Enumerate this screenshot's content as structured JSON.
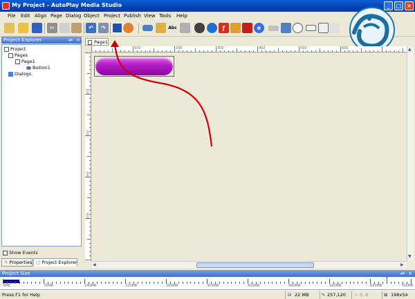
{
  "window": {
    "title": "My Project - AutoPlay Media Studio"
  },
  "menu": [
    "File",
    "Edit",
    "Align",
    "Page",
    "Dialog",
    "Object",
    "Project",
    "Publish",
    "View",
    "Tools",
    "Help"
  ],
  "toolbar": {
    "abc_label": "Abc"
  },
  "project_explorer": {
    "title": "Project Explorer",
    "tree": {
      "project": "Project",
      "pages": "Pages",
      "page1": "Page1",
      "button1": "Button1",
      "dialogs": "Dialogs"
    },
    "show_events_label": "Show Events",
    "tab_properties": "Properties",
    "tab_explorer": "Project Explorer"
  },
  "document": {
    "tab_label": "Page1",
    "ruler_labels": [
      "100",
      "200",
      "300",
      "400",
      "500",
      "600"
    ],
    "vruler_labels": [
      "100",
      "200",
      "300",
      "400"
    ]
  },
  "project_size": {
    "title": "Project Size",
    "fill_fraction": 0.04,
    "scale_labels": [
      "0MB",
      "70MB",
      "140MB",
      "210MB",
      "280MB",
      "350MB",
      "420MB",
      "490MB",
      "560MB",
      "630MB",
      "700MB"
    ]
  },
  "statusbar": {
    "help": "Press F1 for Help",
    "size": "22 MB",
    "coords": "257,120",
    "pos": "0, 0",
    "dims": "198x54"
  },
  "colors": {
    "titlebar": "#0842b0",
    "button_fill": "#b11ac4",
    "annotation_arrow": "#cc0000"
  }
}
